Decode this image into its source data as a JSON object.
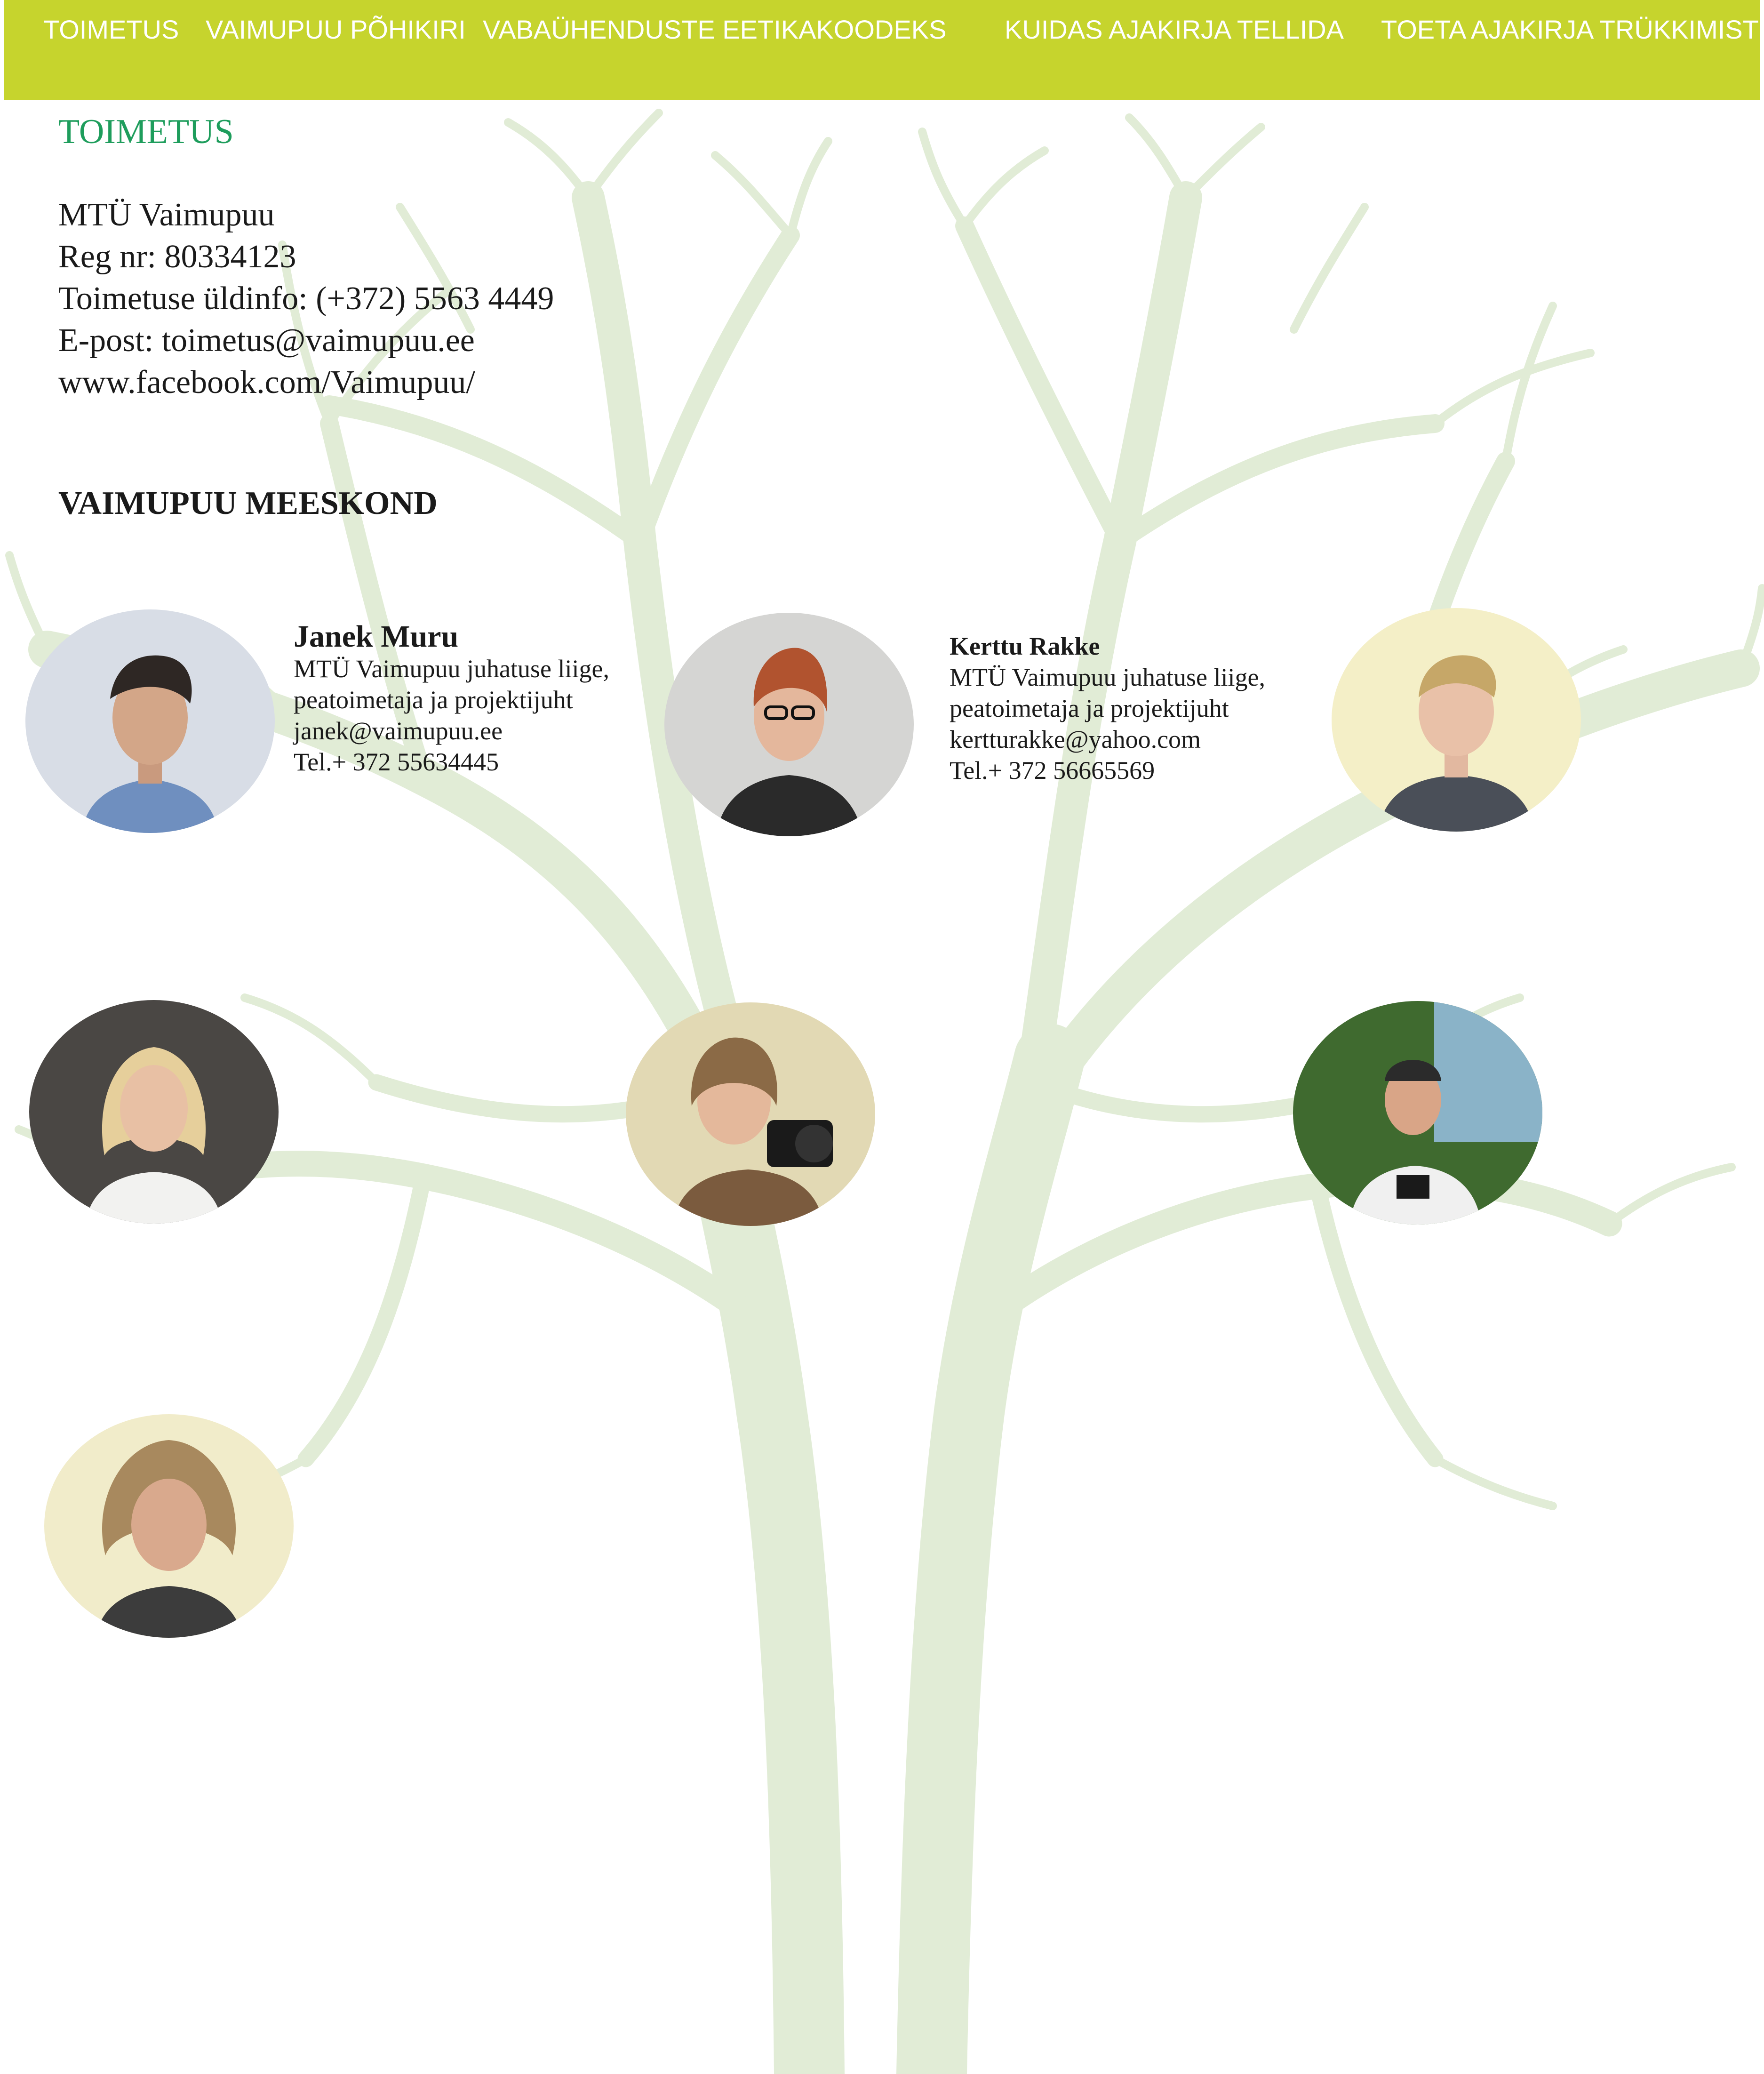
{
  "nav": {
    "items": [
      {
        "label": "TOIMETUS"
      },
      {
        "label": "VAIMUPUU PÕHIKIRI"
      },
      {
        "label": "VABAÜHENDUSTE EETIKAKOODEKS"
      },
      {
        "label": "KUIDAS AJAKIRJA TELLIDA"
      },
      {
        "label": "TOETA AJAKIRJA TRÜKKIMIST"
      }
    ]
  },
  "section_title": "TOIMETUS",
  "organization": {
    "name": "MTÜ Vaimupuu",
    "reg": "Reg nr: 80334123",
    "phone": "Toimetuse üldinfo: (+372) 5563 4449",
    "email": "E-post: toimetus@vaimupuu.ee",
    "facebook": "www.facebook.com/Vaimupuu/"
  },
  "team": {
    "title": "VAIMUPUU MEESKOND",
    "members": [
      {
        "name": "Janek Muru",
        "role_line1": "MTÜ Vaimupuu juhatuse liige,",
        "role_line2": "peatoimetaja ja projektijuht",
        "email": "janek@vaimupuu.ee",
        "phone": "Tel.+ 372 55634445"
      },
      {
        "name": "Kerttu Rakke",
        "role_line1": "MTÜ Vaimupuu juhatuse liige,",
        "role_line2": "peatoimetaja ja projektijuht",
        "email": "kertturakke@yahoo.com",
        "phone": "Tel.+ 372 56665569"
      }
    ]
  },
  "colors": {
    "nav_bg": "#c6d42d",
    "title_green": "#1e9d5c",
    "tree": "#e1ecd6"
  }
}
